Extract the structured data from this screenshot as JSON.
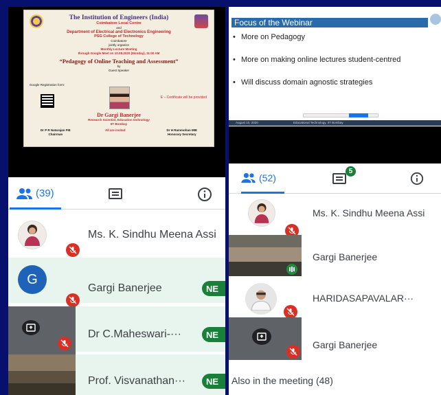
{
  "left_panel": {
    "poster": {
      "org": "The Institution of Engineers (India)",
      "centre": "Coimbatore Local Centre",
      "and": "and",
      "dept": "Department of Electrical and Electronics Engineering",
      "college": "PSG College of Technology",
      "city": "Coimbatore",
      "jointly": "jointly organize",
      "event": "Monthly Lecture Meeting",
      "event_detail": "through Google Meet on 10.08.2020 (Monday), 11:00 AM",
      "topic": "“Pedagogy of Online Teaching and Assessment”",
      "by": "by",
      "guest": "Guest Speaker",
      "reg_label": "Google Registration form:",
      "cert_note": "E – Certificate will be provided",
      "speaker_name": "Dr Gargi Banerjee",
      "speaker_role": "Research Scientist, Education technology",
      "speaker_org": "IIT Bombay",
      "chair_name": "Dr P R Natarajan FIE",
      "chair_role": "Chairman",
      "invite": "All are invited",
      "sec_name": "Dr H Rammohan MIE",
      "sec_role": "Honorary Secretary"
    },
    "tabs": {
      "people_count": "(39)"
    },
    "participants": [
      {
        "name": "Ms. K. Sindhu Meena Assi"
      },
      {
        "name": "Gargi Banerjee",
        "initial": "G",
        "chip": "NE"
      },
      {
        "name": "Dr C.Maheswari-···",
        "chip": "NE"
      },
      {
        "name": "Prof. Visvanathan···",
        "chip": "NE"
      }
    ]
  },
  "right_panel": {
    "slide": {
      "title": "Focus of the Webinar",
      "bullets": [
        "More on Pedagogy",
        "More on making online lectures student-centred",
        "Will discuss domain agnostic strategies"
      ],
      "footer_date": "August 10, 2020",
      "footer_org": "Educational Technology, IIT Bombay"
    },
    "tabs": {
      "people_count": "(52)",
      "chat_badge": "5"
    },
    "participants": [
      {
        "name": "Ms. K. Sindhu Meena Assi"
      },
      {
        "name": "Gargi Banerjee"
      },
      {
        "name": "HARIDASAPAVALAR···"
      },
      {
        "name": "Gargi Banerjee"
      }
    ],
    "also_in_meeting": "Also in the meeting (48)"
  },
  "colors": {
    "background": "#08106e",
    "accent": "#1a73e8",
    "mic_off": "#d93025",
    "chip": "#188038"
  }
}
